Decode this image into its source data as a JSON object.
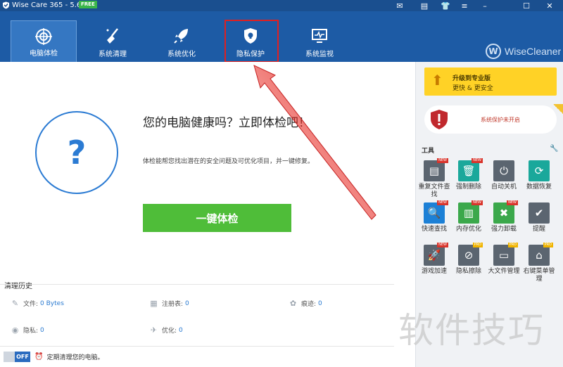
{
  "window": {
    "title": "Wise Care 365 - 5.6.6",
    "badge": "FREE",
    "controls": [
      "mail-icon",
      "feedback-icon",
      "skin-icon",
      "menu-icon",
      "minimize-icon",
      "maximize-icon",
      "close-icon"
    ]
  },
  "nav": {
    "items": [
      {
        "label": "电脑体检",
        "icon": "target-icon",
        "active": true
      },
      {
        "label": "系统清理",
        "icon": "broom-icon",
        "active": false
      },
      {
        "label": "系统优化",
        "icon": "rocket-icon",
        "active": false
      },
      {
        "label": "隐私保护",
        "icon": "privacy-shield-icon",
        "active": false,
        "highlighted": true
      },
      {
        "label": "系统监视",
        "icon": "monitor-icon",
        "active": false
      }
    ],
    "brand": {
      "letter": "W",
      "name": "WiseCleaner"
    }
  },
  "main": {
    "question_mark": "?",
    "headline": "您的电脑健康吗？立即体检吧！",
    "description": "体检能帮您找出潜在的安全问题及可优化项目，并一键修复。",
    "scan_button": "一键体检"
  },
  "history": {
    "title": "清理历史",
    "items": [
      {
        "label": "文件:",
        "value": "0 Bytes",
        "icon": "broom-small-icon"
      },
      {
        "label": "注册表:",
        "value": "0",
        "icon": "registry-icon"
      },
      {
        "label": "痕迹:",
        "value": "0",
        "icon": "footprint-icon"
      },
      {
        "label": "隐私:",
        "value": "0",
        "icon": "eye-icon"
      },
      {
        "label": "优化:",
        "value": "0",
        "icon": "plane-icon"
      }
    ]
  },
  "schedule": {
    "toggle_state": "OFF",
    "text": "定期清理您的电脑。"
  },
  "sidebar": {
    "upgrade_title": "升级到专业版",
    "upgrade_sub": "更快 & 更安全",
    "protection_status": "系统保护未开启",
    "tools_title": "工具",
    "tools": [
      {
        "label": "重复文件查找",
        "icon": "duplicate-file-icon",
        "badge": "NEW"
      },
      {
        "label": "强制删除",
        "icon": "trash-icon",
        "badge": "NEW"
      },
      {
        "label": "自动关机",
        "icon": "power-icon",
        "badge": ""
      },
      {
        "label": "数据恢复",
        "icon": "recover-icon",
        "badge": ""
      },
      {
        "label": "快速查找",
        "icon": "search-icon",
        "badge": "NEW"
      },
      {
        "label": "内存优化",
        "icon": "memory-icon",
        "badge": "NEW"
      },
      {
        "label": "强力卸载",
        "icon": "uninstall-icon",
        "badge": "NEW"
      },
      {
        "label": "提醒",
        "icon": "reminder-icon",
        "badge": ""
      },
      {
        "label": "游戏加速",
        "icon": "game-rocket-icon",
        "badge": "NEW"
      },
      {
        "label": "隐私擦除",
        "icon": "eye-off-icon",
        "badge": "PRO"
      },
      {
        "label": "大文件管理",
        "icon": "folder-icon",
        "badge": "PRO"
      },
      {
        "label": "右键菜单管理",
        "icon": "mouse-icon",
        "badge": "PRO"
      }
    ]
  },
  "watermark": "软件技巧",
  "colors": {
    "header": "#1d5ba5",
    "titlebar": "#1a4f8f",
    "scan_button": "#4fbd39",
    "upgrade": "#ffd226",
    "annotation": "#e02020"
  }
}
